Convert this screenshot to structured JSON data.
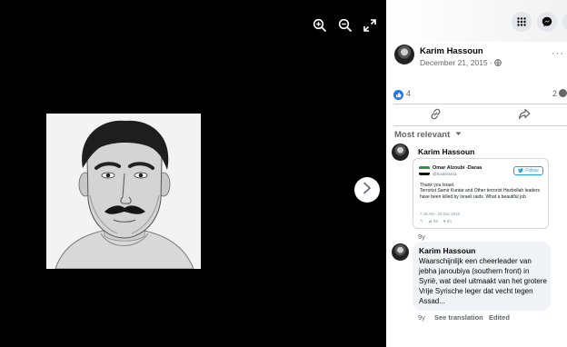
{
  "viewer": {
    "tools": [
      {
        "name": "zoom-in-icon"
      },
      {
        "name": "zoom-out-icon"
      },
      {
        "name": "fullscreen-icon"
      }
    ],
    "next_icon": "chevron-right-icon"
  },
  "topbar": {
    "icons": [
      "menu-grid-icon",
      "messenger-icon",
      "notifications-icon"
    ]
  },
  "post": {
    "author": "Karim Hassoun",
    "date": "December 21, 2015 ·",
    "more": "···",
    "reactions": {
      "like_count": "4",
      "share_count": "2"
    }
  },
  "comments": {
    "sort_label": "Most relevant",
    "items": [
      {
        "author": "Karim Hassoun",
        "tweet": {
          "name": "Omar Alzoubi -Daraa",
          "handle": "@hooleran11",
          "follow_label": "Follow",
          "text": "Thank you Israel.\nTerrorist Samir Kuntar and Other terrorist Hezbollah leaders have been killed by Israeli raids. What a beautiful job",
          "time": "7:49 AM - 20 Dec 2015",
          "retweets": "55",
          "likes": "60"
        },
        "age": "9y"
      },
      {
        "author": "Karim Hassoun",
        "text": "Waarschijnlijk een cheerleader van jebha janoubiya (southern front) in Syrië, wat deel uitmaakt van het grotere Vrije Syrische leger dat vecht tegen Assad...",
        "age": "9y",
        "see_translation": "See translation",
        "edited": "Edited"
      }
    ]
  },
  "colors": {
    "like_blue": "#1877f2",
    "muted_text": "#65676b",
    "bubble_bg": "#f0f2f5",
    "twitter_blue": "#1da1f2"
  }
}
